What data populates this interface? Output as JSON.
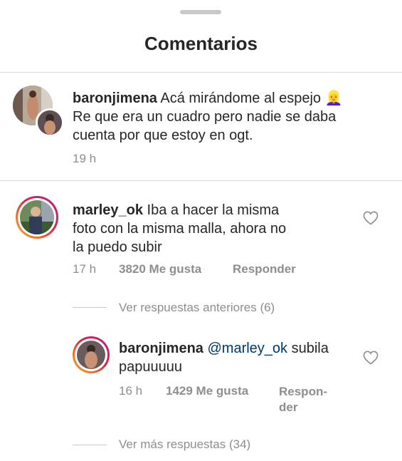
{
  "header": {
    "title": "Comentarios"
  },
  "caption": {
    "username": "baronjimena",
    "text": "Acá mirándome al espejo 👱‍♀️ Re que era un cuadro pero nadie se daba cuenta por que estoy en ogt.",
    "line1": "Acá mirándome al espejo",
    "emoji": "👱‍♀️",
    "line2": "Re que era un cuadro pero nadie se daba",
    "line3": "cuenta por que estoy en ogt.",
    "time": "19 h"
  },
  "comment": {
    "username": "marley_ok",
    "line1": "Iba a hacer la misma",
    "line2": "foto con la misma malla, ahora no",
    "line3": "la puedo subir",
    "time": "17 h",
    "likes": "3820 Me gusta",
    "reply_label": "Responder"
  },
  "previous_replies": "Ver respuestas anteriores (6)",
  "reply": {
    "username": "baronjimena",
    "mention": "@marley_ok",
    "rest": "subila",
    "line2": "papuuuuu",
    "time": "16 h",
    "likes": "1429 Me gusta",
    "reply_label_1": "Respon-",
    "reply_label_2": "der"
  },
  "more_replies": "Ver más respuestas (34)",
  "colors": {
    "text": "#262626",
    "muted": "#8e8e8e",
    "mention": "#00376b",
    "divider": "#dbdbdb"
  }
}
